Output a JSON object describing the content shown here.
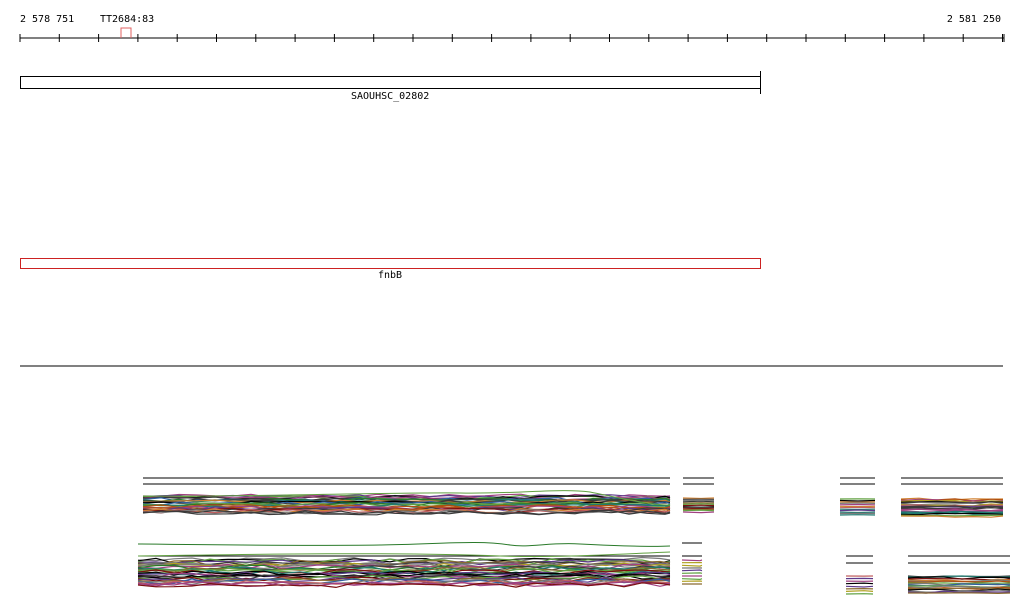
{
  "ruler": {
    "start_label": "2 578 751",
    "end_label": "2 581 250",
    "marker_label": "TT2684:83",
    "marker_color": "#e06060"
  },
  "tracks": [
    {
      "name": "SAOUHSC_02802",
      "color": "#000000"
    },
    {
      "name": "fnbB",
      "color": "#cc2222"
    }
  ],
  "alignment_palette": [
    "#000000",
    "#3a3a3a",
    "#7a7a7a",
    "#2a7a2a",
    "#7a1010",
    "#b05010",
    "#2f5fa0",
    "#a04080",
    "#b0a020",
    "#c06060",
    "#5e3a8a",
    "#207a70",
    "#8a6a30",
    "#d08030",
    "#60a040"
  ]
}
